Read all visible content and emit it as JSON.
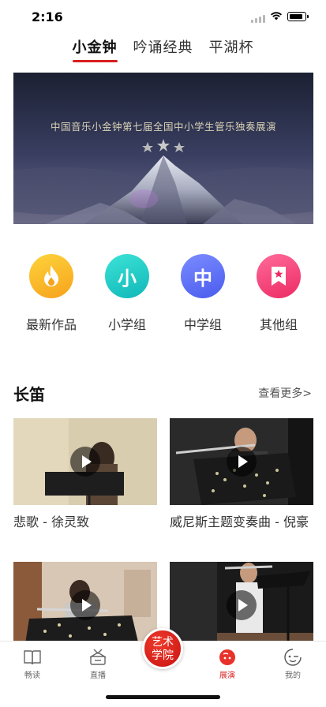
{
  "status": {
    "time": "2:16"
  },
  "top_tabs": [
    {
      "label": "小金钟",
      "active": true
    },
    {
      "label": "吟诵经典",
      "active": false
    },
    {
      "label": "平湖杯",
      "active": false
    }
  ],
  "banner": {
    "text": "中国音乐小金钟第七届全国中小学生管乐独奏展演"
  },
  "categories": [
    {
      "label": "最新作品",
      "icon": "flame-icon",
      "glyph": "",
      "color_from": "#fdd33b",
      "color_to": "#f7a21c"
    },
    {
      "label": "小学组",
      "icon": "primary-icon",
      "glyph": "小",
      "color_from": "#3ce3d6",
      "color_to": "#10b7b9"
    },
    {
      "label": "中学组",
      "icon": "secondary-icon",
      "glyph": "中",
      "color_from": "#7b8cff",
      "color_to": "#4a5bee"
    },
    {
      "label": "其他组",
      "icon": "bookmark-star-icon",
      "glyph": "",
      "color_from": "#ff6b9a",
      "color_to": "#ec2a63"
    }
  ],
  "section": {
    "title": "长笛",
    "more": "查看更多>"
  },
  "videos": [
    {
      "title": "悲歌 - 徐灵致"
    },
    {
      "title": "威尼斯主题变奏曲 - 倪豪"
    },
    {
      "title": ""
    },
    {
      "title": ""
    }
  ],
  "tabbar": {
    "items": [
      {
        "label": "畅读",
        "icon": "book-icon",
        "active": false
      },
      {
        "label": "直播",
        "icon": "tv-icon",
        "active": false
      },
      {
        "label": "展演",
        "icon": "perform-icon",
        "active": true
      },
      {
        "label": "我的",
        "icon": "profile-icon",
        "active": false
      }
    ],
    "center_label": "艺术学院"
  },
  "colors": {
    "accent": "#d81e1e"
  }
}
